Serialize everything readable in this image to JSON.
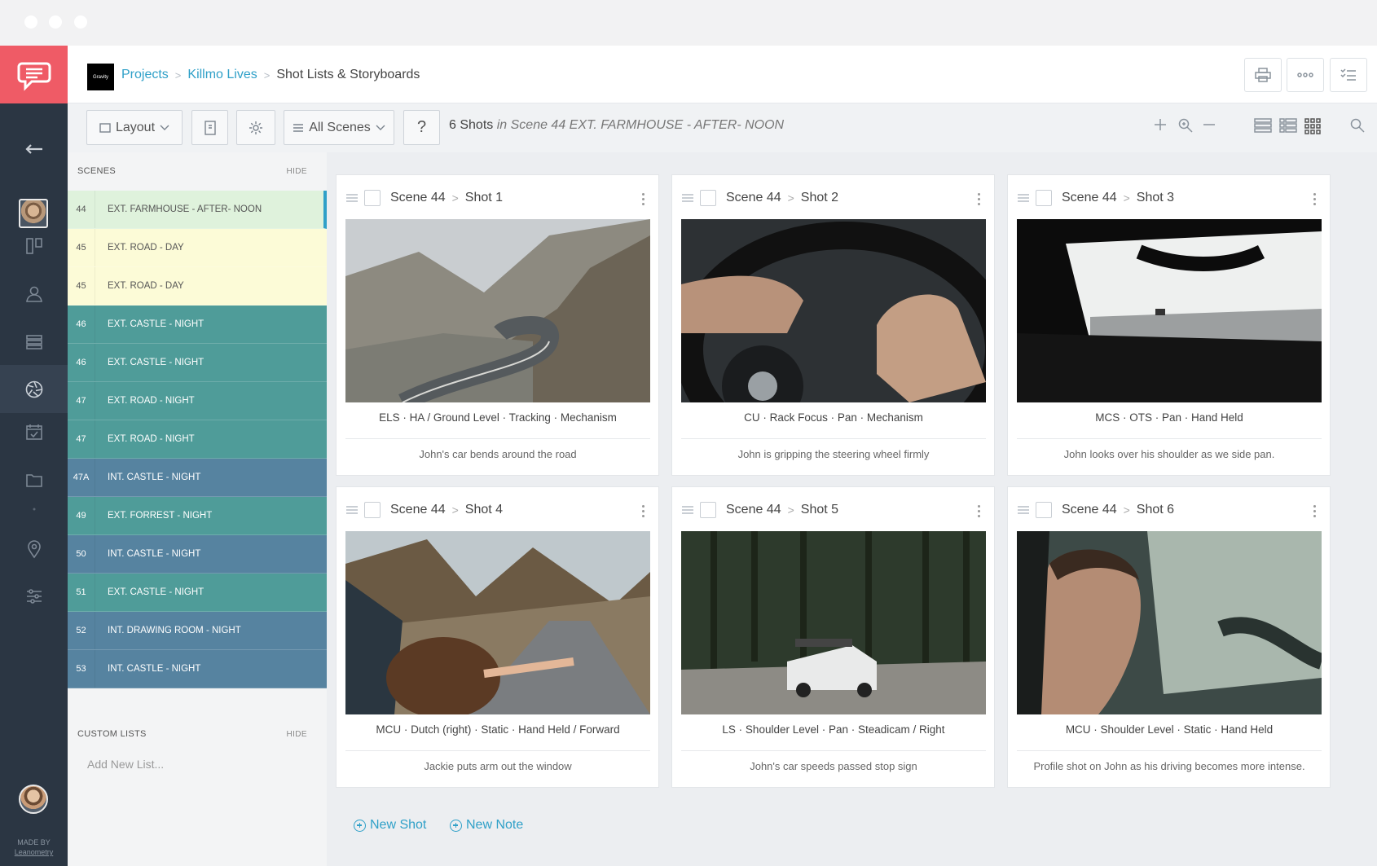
{
  "brand": {
    "label": "Gravity"
  },
  "breadcrumb": {
    "projects": "Projects",
    "project": "Killmo Lives",
    "current": "Shot Lists & Storyboards"
  },
  "toolbar": {
    "layout_label": "Layout",
    "scenes_filter": "All Scenes",
    "help_label": "?",
    "shots_count": "6 Shots",
    "shots_context": "in Scene 44 EXT. FARMHOUSE - AFTER- NOON"
  },
  "scenes_panel": {
    "title": "SCENES",
    "hide_label": "HIDE",
    "items": [
      {
        "num": "44",
        "name": "EXT. FARMHOUSE - AFTER- NOON",
        "color": "#dff2dc",
        "text": "#555",
        "active": true
      },
      {
        "num": "45",
        "name": "EXT. ROAD - DAY",
        "color": "#fcfbd7",
        "text": "#555"
      },
      {
        "num": "45",
        "name": "EXT. ROAD - DAY",
        "color": "#fcfbd7",
        "text": "#555"
      },
      {
        "num": "46",
        "name": "EXT. CASTLE - NIGHT",
        "color": "#4f9c99",
        "text": "#ffffff"
      },
      {
        "num": "46",
        "name": "EXT. CASTLE - NIGHT",
        "color": "#4f9c99",
        "text": "#ffffff"
      },
      {
        "num": "47",
        "name": "EXT. ROAD - NIGHT",
        "color": "#4f9c99",
        "text": "#ffffff"
      },
      {
        "num": "47",
        "name": "EXT. ROAD - NIGHT",
        "color": "#4f9c99",
        "text": "#ffffff"
      },
      {
        "num": "47A",
        "name": "INT. CASTLE - NIGHT",
        "color": "#5683a0",
        "text": "#ffffff"
      },
      {
        "num": "49",
        "name": "EXT. FORREST - NIGHT",
        "color": "#4f9c99",
        "text": "#ffffff"
      },
      {
        "num": "50",
        "name": "INT. CASTLE - NIGHT",
        "color": "#5683a0",
        "text": "#ffffff"
      },
      {
        "num": "51",
        "name": "EXT. CASTLE - NIGHT",
        "color": "#4f9c99",
        "text": "#ffffff"
      },
      {
        "num": "52",
        "name": "INT. DRAWING ROOM - NIGHT",
        "color": "#5683a0",
        "text": "#ffffff"
      },
      {
        "num": "53",
        "name": "INT. CASTLE - NIGHT",
        "color": "#5683a0",
        "text": "#ffffff"
      }
    ]
  },
  "custom_lists": {
    "title": "CUSTOM LISTS",
    "hide_label": "HIDE",
    "placeholder": "Add New List..."
  },
  "shots": [
    {
      "scene": "Scene 44",
      "shot": "Shot 1",
      "specs": "ELS  ·  HA / Ground Level  ·  Tracking  ·  Mechanism",
      "description": "John's car bends around the road"
    },
    {
      "scene": "Scene 44",
      "shot": "Shot 2",
      "specs": "CU  ·  Rack Focus  ·  Pan  ·  Mechanism",
      "description": "John is gripping the steering wheel firmly"
    },
    {
      "scene": "Scene 44",
      "shot": "Shot 3",
      "specs": "MCS  ·  OTS  ·  Pan  ·  Hand Held",
      "description": "John looks over his shoulder as we side pan."
    },
    {
      "scene": "Scene 44",
      "shot": "Shot 4",
      "specs": "MCU  ·  Dutch (right)  ·  Static  ·  Hand Held / Forward",
      "description": "Jackie puts arm out the window"
    },
    {
      "scene": "Scene 44",
      "shot": "Shot 5",
      "specs": "LS  ·  Shoulder Level  ·  Pan  ·  Steadicam / Right",
      "description": "John's car speeds passed stop sign"
    },
    {
      "scene": "Scene 44",
      "shot": "Shot 6",
      "specs": "MCU  ·  Shoulder Level  ·  Static  ·  Hand Held",
      "description": "Profile shot on John as his driving becomes more intense."
    }
  ],
  "actions": {
    "new_shot": "New Shot",
    "new_note": "New Note"
  },
  "footer": {
    "made_by": "MADE BY",
    "company": "Leanometry"
  },
  "colors": {
    "accent": "#2fa0c8",
    "brand": "#ef5b66",
    "nav_bg": "#2b3643"
  }
}
